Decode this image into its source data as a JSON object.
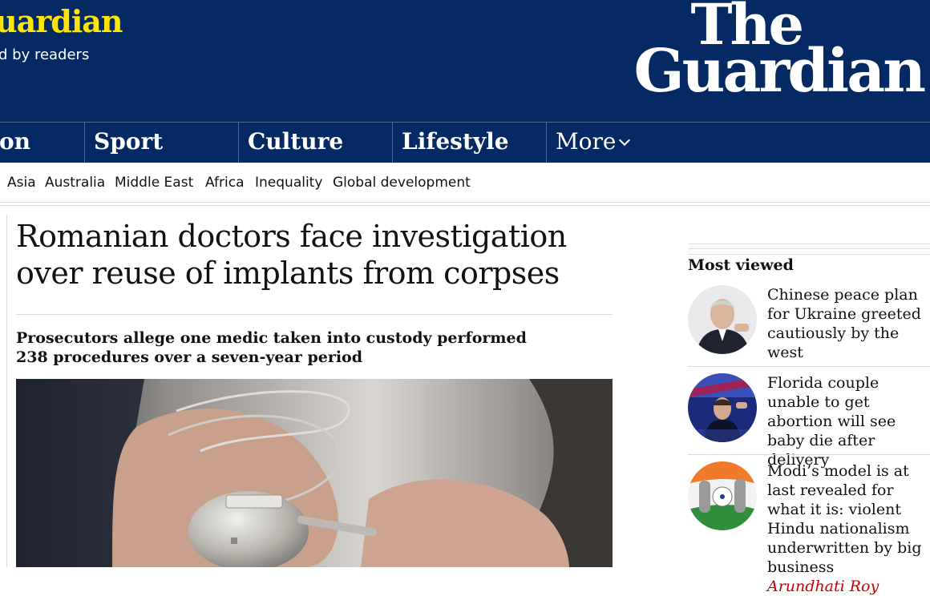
{
  "masthead": {
    "support_title": "uardian",
    "support_sub": "d by readers",
    "logo_line1": "The",
    "logo_line2": "Guardian"
  },
  "nav": {
    "items": [
      "on",
      "Sport",
      "Culture",
      "Lifestyle"
    ],
    "more": "More"
  },
  "subnav": [
    "Asia",
    "Australia",
    "Middle East",
    "Africa",
    "Inequality",
    "Global development"
  ],
  "article": {
    "headline": "Romanian doctors face investigation over reuse of implants from corpses",
    "standfirst": "Prosecutors allege one medic taken into custody performed 238 procedures over a seven-year period"
  },
  "most_viewed": {
    "title": "Most viewed",
    "items": [
      {
        "text": "Chinese peace plan for Ukraine greeted cautiously by the west"
      },
      {
        "text": "Florida couple unable to get abortion will see baby die after delivery"
      },
      {
        "text": "Modi’s model is at last revealed for what it is: violent Hindu nationalism underwritten by big business",
        "byline": "Arundhati Roy"
      }
    ]
  },
  "colors": {
    "brand_navy": "#052962",
    "brand_yellow": "#ffe500",
    "byline_red": "#c70000"
  }
}
